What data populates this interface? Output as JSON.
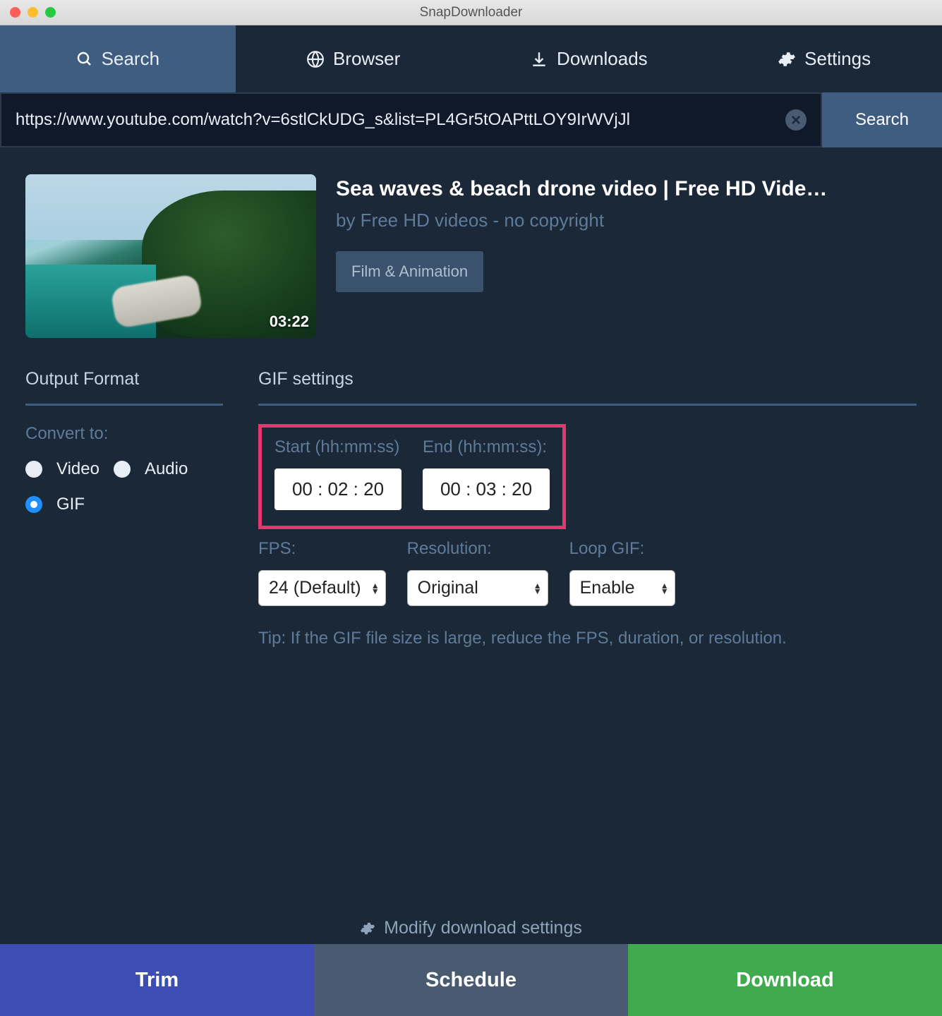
{
  "window": {
    "title": "SnapDownloader"
  },
  "tabs": {
    "search": "Search",
    "browser": "Browser",
    "downloads": "Downloads",
    "settings": "Settings"
  },
  "url": {
    "value": "https://www.youtube.com/watch?v=6stlCkUDG_s&list=PL4Gr5tOAPttLOY9IrWVjJl",
    "search_label": "Search"
  },
  "video": {
    "title": "Sea waves & beach drone video | Free HD Vide…",
    "author": "by Free HD videos - no copyright",
    "duration": "03:22",
    "category": "Film & Animation"
  },
  "panels": {
    "output_heading": "Output Format",
    "gif_heading": "GIF settings",
    "convert_to_label": "Convert to:",
    "radios": {
      "video": "Video",
      "audio": "Audio",
      "gif": "GIF"
    }
  },
  "gif": {
    "start_label": "Start (hh:mm:ss)",
    "end_label": "End (hh:mm:ss):",
    "start_value": "00 : 02 : 20",
    "end_value": "00 : 03 : 20",
    "fps_label": "FPS:",
    "fps_value": "24 (Default)",
    "resolution_label": "Resolution:",
    "resolution_value": "Original",
    "loop_label": "Loop GIF:",
    "loop_value": "Enable",
    "tip": "Tip: If the GIF file size is large, reduce the FPS, duration, or resolution."
  },
  "footer": {
    "modify": "Modify download settings",
    "trim": "Trim",
    "schedule": "Schedule",
    "download": "Download"
  }
}
